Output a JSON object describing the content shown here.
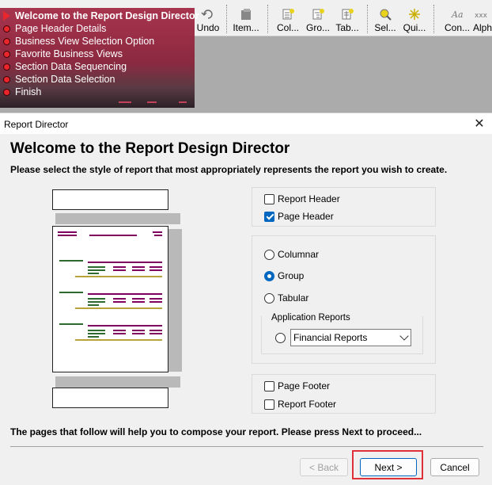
{
  "toolbar": {
    "buttons": [
      {
        "label": "Undo"
      },
      {
        "label": "Item..."
      },
      {
        "label": "Col..."
      },
      {
        "label": "Gro..."
      },
      {
        "label": "Tab..."
      },
      {
        "label": "Sel..."
      },
      {
        "label": "Qui..."
      },
      {
        "label": "Con..."
      },
      {
        "label": "Alph"
      }
    ]
  },
  "steps": {
    "items": [
      {
        "label": "Welcome to the Report Design Director",
        "active": true
      },
      {
        "label": "Page Header Details"
      },
      {
        "label": "Business View Selection Option"
      },
      {
        "label": "Favorite Business Views"
      },
      {
        "label": "Section Data Sequencing"
      },
      {
        "label": "Section Data Selection"
      },
      {
        "label": "Finish"
      }
    ],
    "dot_color": "#e8262c",
    "panel_color": "#a8344e"
  },
  "dialog": {
    "title": "Report Director",
    "heading": "Welcome to the Report Design Director",
    "subheading": "Please select the style of report that most appropriately represents the report you wish to create.",
    "header_options": {
      "report_header": {
        "label": "Report Header",
        "checked": false
      },
      "page_header": {
        "label": "Page Header",
        "checked": true
      }
    },
    "style_options": {
      "columnar": {
        "label": "Columnar",
        "checked": false
      },
      "group": {
        "label": "Group",
        "checked": true
      },
      "tabular": {
        "label": "Tabular",
        "checked": false
      }
    },
    "application_reports": {
      "legend": "Application Reports",
      "selected": "Financial Reports",
      "checked": false
    },
    "footer_options": {
      "page_footer": {
        "label": "Page Footer",
        "checked": false
      },
      "report_footer": {
        "label": "Report Footer",
        "checked": false
      }
    },
    "footer_text": "The pages that follow will help you to compose your report.  Please press Next to proceed...",
    "buttons": {
      "back": "< Back",
      "next": "Next >",
      "cancel": "Cancel"
    },
    "colors": {
      "accent": "#0067c0",
      "highlight": "#e0313a"
    }
  }
}
